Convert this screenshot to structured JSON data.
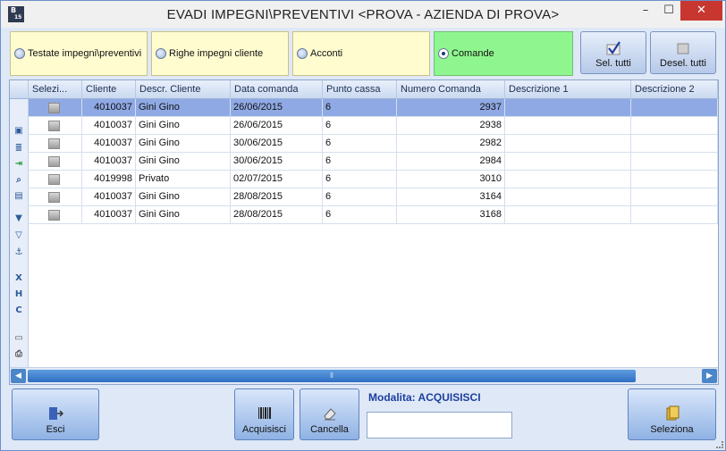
{
  "window": {
    "title": "EVADI IMPEGNI\\PREVENTIVI <PROVA - AZIENDA DI PROVA>",
    "icon_text_top": "B",
    "icon_text_bottom": "15",
    "min_symbol": "–",
    "max_symbol": "☐",
    "close_symbol": "✕"
  },
  "modes": [
    {
      "label": "Testate impegni\\preventivi",
      "selected": false
    },
    {
      "label": "Righe impegni cliente",
      "selected": false
    },
    {
      "label": "Acconti",
      "selected": false
    },
    {
      "label": "Comande",
      "selected": true
    }
  ],
  "toolbar": {
    "select_all_label": "Sel. tutti",
    "deselect_all_label": "Desel. tutti"
  },
  "grid": {
    "columns": [
      "Selezi...",
      "Cliente",
      "Descr. Cliente",
      "Data comanda",
      "Punto cassa",
      "Numero Comanda",
      "Descrizione 1",
      "Descrizione 2"
    ],
    "rows": [
      {
        "cliente": "4010037",
        "descr": "Gini Gino",
        "data": "26/06/2015",
        "punto": "6",
        "numero": "2937",
        "selected": true
      },
      {
        "cliente": "4010037",
        "descr": "Gini Gino",
        "data": "26/06/2015",
        "punto": "6",
        "numero": "2938",
        "selected": false
      },
      {
        "cliente": "4010037",
        "descr": "Gini Gino",
        "data": "30/06/2015",
        "punto": "6",
        "numero": "2982",
        "selected": false
      },
      {
        "cliente": "4010037",
        "descr": "Gini Gino",
        "data": "30/06/2015",
        "punto": "6",
        "numero": "2984",
        "selected": false
      },
      {
        "cliente": "4019998",
        "descr": "Privato",
        "data": "02/07/2015",
        "punto": "6",
        "numero": "3010",
        "selected": false
      },
      {
        "cliente": "4010037",
        "descr": "Gini Gino",
        "data": "28/08/2015",
        "punto": "6",
        "numero": "3164",
        "selected": false
      },
      {
        "cliente": "4010037",
        "descr": "Gini Gino",
        "data": "28/08/2015",
        "punto": "6",
        "numero": "3168",
        "selected": false
      }
    ],
    "side_icons": [
      "layout-icon",
      "list-icon",
      "export-icon",
      "search-icon",
      "columns-icon",
      "filter-icon",
      "filter-clear-icon",
      "anchor-icon",
      "export-x-icon",
      "export-h-icon",
      "export-c-icon",
      "monitor-icon",
      "print-icon"
    ]
  },
  "footer": {
    "exit_label": "Esci",
    "acquire_label": "Acquisisci",
    "delete_label": "Cancella",
    "mode_text": "Modalita: ACQUISISCI",
    "mode_input_value": "",
    "select_label": "Seleziona"
  },
  "colors": {
    "mode_box": "#fffcd0",
    "mode_box_selected": "#8ff68f",
    "row_selected": "#8fa9e4",
    "accent": "#1b3f9e"
  }
}
